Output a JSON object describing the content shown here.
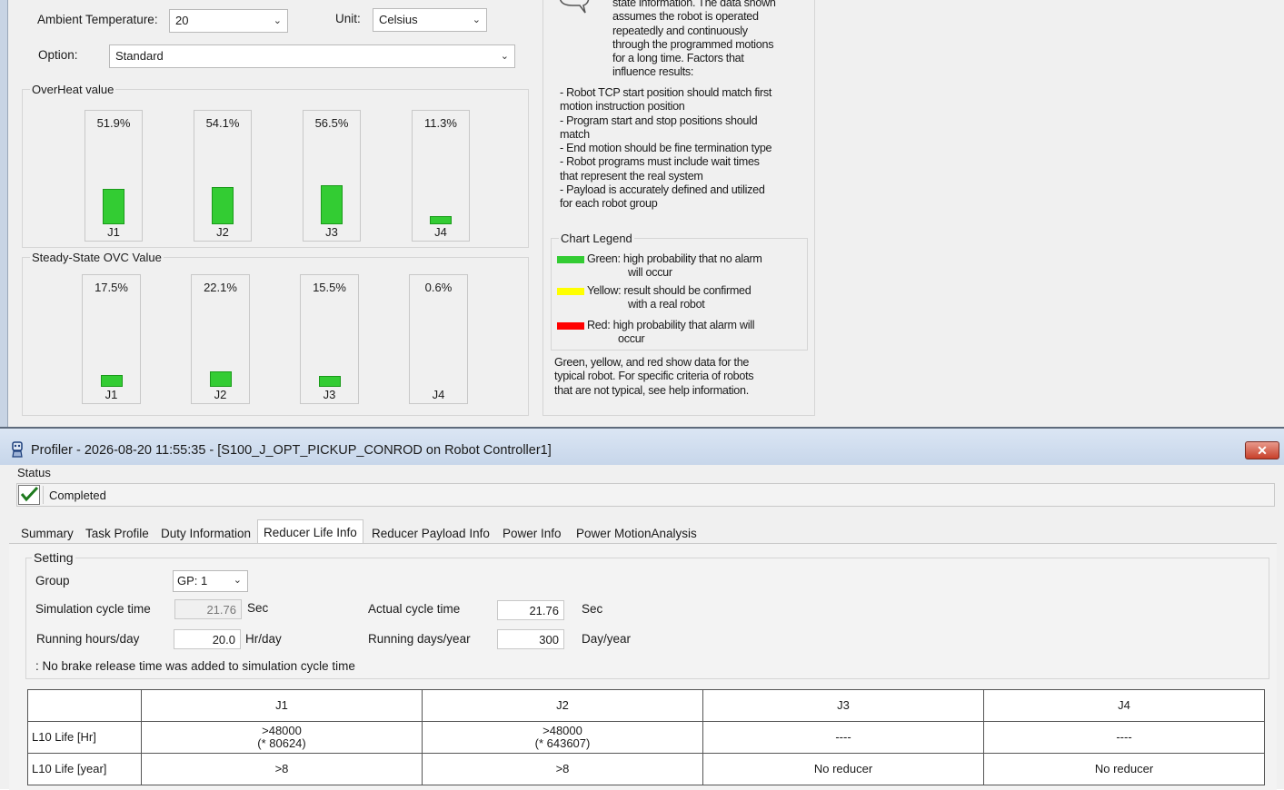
{
  "top_panel": {
    "ambient_temperature": {
      "label": "Ambient Temperature:",
      "value": "20"
    },
    "unit": {
      "label": "Unit:",
      "value": "Celsius"
    },
    "option": {
      "label": "Option:",
      "value": "Standard"
    },
    "overheat": {
      "title": "OverHeat value",
      "bars": [
        {
          "label": "J1",
          "value_text": "51.9%",
          "value": 51.9
        },
        {
          "label": "J2",
          "value_text": "54.1%",
          "value": 54.1
        },
        {
          "label": "J3",
          "value_text": "56.5%",
          "value": 56.5
        },
        {
          "label": "J4",
          "value_text": "11.3%",
          "value": 11.3
        }
      ]
    },
    "ovc": {
      "title": "Steady-State OVC Value",
      "bars": [
        {
          "label": "J1",
          "value_text": "17.5%",
          "value": 17.5
        },
        {
          "label": "J2",
          "value_text": "22.1%",
          "value": 22.1
        },
        {
          "label": "J3",
          "value_text": "15.5%",
          "value": 15.5
        },
        {
          "label": "J4",
          "value_text": "0.6%",
          "value": 0.6
        }
      ]
    },
    "info_lines": [
      "state information. The data shown",
      "assumes the robot is operated",
      "repeatedly and continuously",
      "through the programmed motions",
      "for a long time. Factors that",
      "influence results:"
    ],
    "factor_lines": [
      "- Robot TCP start position should match first",
      "motion instruction position",
      "- Program start and stop positions should",
      "match",
      "- End motion should be fine termination type",
      "- Robot programs must include wait times",
      "that represent the real system",
      "- Payload is accurately defined and utilized",
      "for each robot group"
    ],
    "legend": {
      "title": "Chart Legend",
      "green_color": "#33cc33",
      "yellow_color": "#ffff00",
      "red_color": "#ff0000",
      "green_lines": [
        "Green: high probability that no alarm",
        "will occur"
      ],
      "yellow_lines": [
        "Yellow: result should be confirmed",
        "with a real robot"
      ],
      "red_lines": [
        "Red: high probability that alarm will",
        "occur"
      ]
    },
    "footer_lines": [
      "Green, yellow, and red show data for the",
      "typical robot. For specific criteria of robots",
      "that are not typical, see help information."
    ]
  },
  "profiler": {
    "title": "Profiler - 2026-08-20 11:55:35 - [S100_J_OPT_PICKUP_CONROD on Robot Controller1]",
    "close_label": "✕",
    "status_label": "Status",
    "status_text": "Completed",
    "tabs": [
      "Summary",
      "Task Profile",
      "Duty Information",
      "Reducer Life Info",
      "Reducer Payload Info",
      "Power Info",
      "Power MotionAnalysis"
    ],
    "active_tab": "Reducer Life Info",
    "setting": {
      "title": "Setting",
      "group_label": "Group",
      "group_value": "GP: 1",
      "sim_cycle_label": "Simulation cycle time",
      "sim_cycle_value": "21.76",
      "sim_cycle_unit": "Sec",
      "actual_cycle_label": "Actual cycle time",
      "actual_cycle_value": "21.76",
      "actual_cycle_unit": "Sec",
      "running_hours_label": "Running hours/day",
      "running_hours_value": "20.0",
      "running_hours_unit": "Hr/day",
      "running_days_label": "Running days/year",
      "running_days_value": "300",
      "running_days_unit": "Day/year",
      "note": ": No brake release time was added to simulation cycle time"
    },
    "table": {
      "columns": [
        "",
        "J1",
        "J2",
        "J3",
        "J4"
      ],
      "rows": [
        {
          "label": "L10 Life [Hr]",
          "cells": [
            [
              ">48000",
              "(* 80624)"
            ],
            [
              ">48000",
              "(* 643607)"
            ],
            [
              "----"
            ],
            [
              "----"
            ]
          ]
        },
        {
          "label": "L10 Life [year]",
          "cells": [
            [
              ">8"
            ],
            [
              ">8"
            ],
            [
              "No reducer"
            ],
            [
              "No reducer"
            ]
          ]
        }
      ]
    }
  }
}
